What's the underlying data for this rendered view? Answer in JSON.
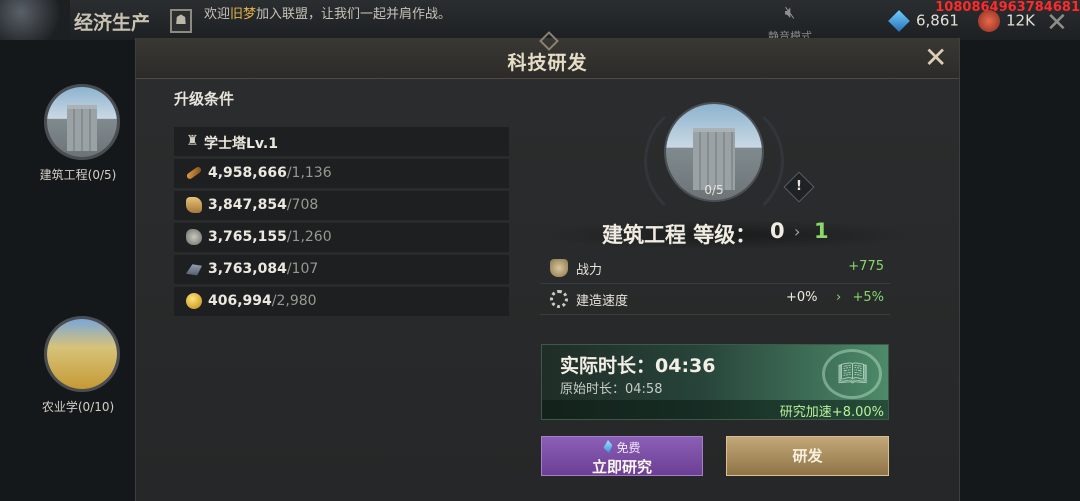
{
  "topbar": {
    "section_title": "经济生产",
    "chat_prefix": "欢迎",
    "chat_name": "旧梦",
    "chat_suffix": "加入联盟，让我们一起并肩作战。",
    "mute_label": "静音模式",
    "gems": "6,861",
    "roses": "12K",
    "overlay_id": "1080864963784681"
  },
  "sidebar": {
    "items": [
      {
        "label": "建筑工程(0/5)",
        "art": "castle"
      },
      {
        "label": "农业学(0/10)",
        "art": "wheat"
      }
    ]
  },
  "dialog": {
    "title": "科技研发",
    "requirements_title": "升级条件",
    "requirements": [
      {
        "icon": "tower-icon",
        "text": "学士塔Lv.1",
        "need": ""
      },
      {
        "icon": "wood-icon",
        "text": "4,958,666",
        "need": "/1,136"
      },
      {
        "icon": "food-icon",
        "text": "3,847,854",
        "need": "/708"
      },
      {
        "icon": "stone-icon",
        "text": "3,765,155",
        "need": "/1,260"
      },
      {
        "icon": "iron-icon",
        "text": "3,763,084",
        "need": "/107"
      },
      {
        "icon": "gold-icon",
        "text": "406,994",
        "need": "/2,980"
      }
    ],
    "tech": {
      "progress": "0/5",
      "name": "建筑工程 等级：",
      "level_current": "0",
      "level_next": "1"
    },
    "stats": [
      {
        "icon": "fist-icon",
        "label": "战力",
        "current": "",
        "next": "+775"
      },
      {
        "icon": "gear-icon",
        "label": "建造速度",
        "current": "+0%",
        "next": "+5%"
      }
    ],
    "time": {
      "actual": "实际时长：04:36",
      "original": "原始时长：04:58",
      "bonus": "研究加速+8.00%"
    },
    "buttons": {
      "instant_free": "免费",
      "instant_main": "立即研究",
      "research": "研发"
    }
  },
  "colors": {
    "accent_green": "#8ad86a",
    "instant_button": "#7a4ca5",
    "research_button": "#a88d5e"
  }
}
